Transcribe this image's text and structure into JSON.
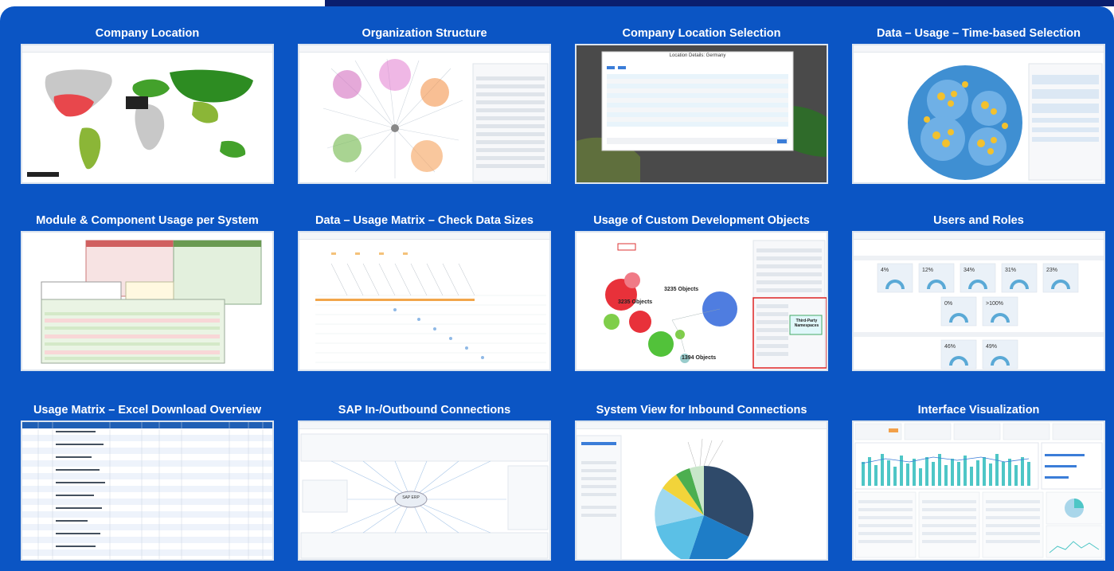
{
  "tiles": [
    {
      "title": "Company Location"
    },
    {
      "title": "Organization Structure"
    },
    {
      "title": "Company Location Selection"
    },
    {
      "title": "Data – Usage – Time-based Selection"
    },
    {
      "title": "Module & Component Usage per System"
    },
    {
      "title": "Data – Usage Matrix – Check Data Sizes"
    },
    {
      "title": "Usage of Custom Development Objects"
    },
    {
      "title": "Users and Roles"
    },
    {
      "title": "Usage Matrix – Excel Download Overview"
    },
    {
      "title": "SAP In-/Outbound Connections"
    },
    {
      "title": "System View for Inbound Connections"
    },
    {
      "title": "Interface Visualization"
    }
  ],
  "shots": {
    "location_selection_dialog_title": "Location Details: Germany",
    "custom_dev_labels": [
      "3235 Objects",
      "3235 Objects",
      "1394 Objects"
    ],
    "custom_dev_callout": "Third-Party Namespaces",
    "inout_center_label": "SAP ERP",
    "users_roles_values": [
      "4%",
      "12%",
      "34%",
      "31%",
      "23%",
      "0%",
      ">100%",
      "46%",
      "49%"
    ]
  },
  "colors": {
    "background": "#0b55c4",
    "top_bar": "#0a1e6e",
    "title_text": "#ffffff"
  }
}
